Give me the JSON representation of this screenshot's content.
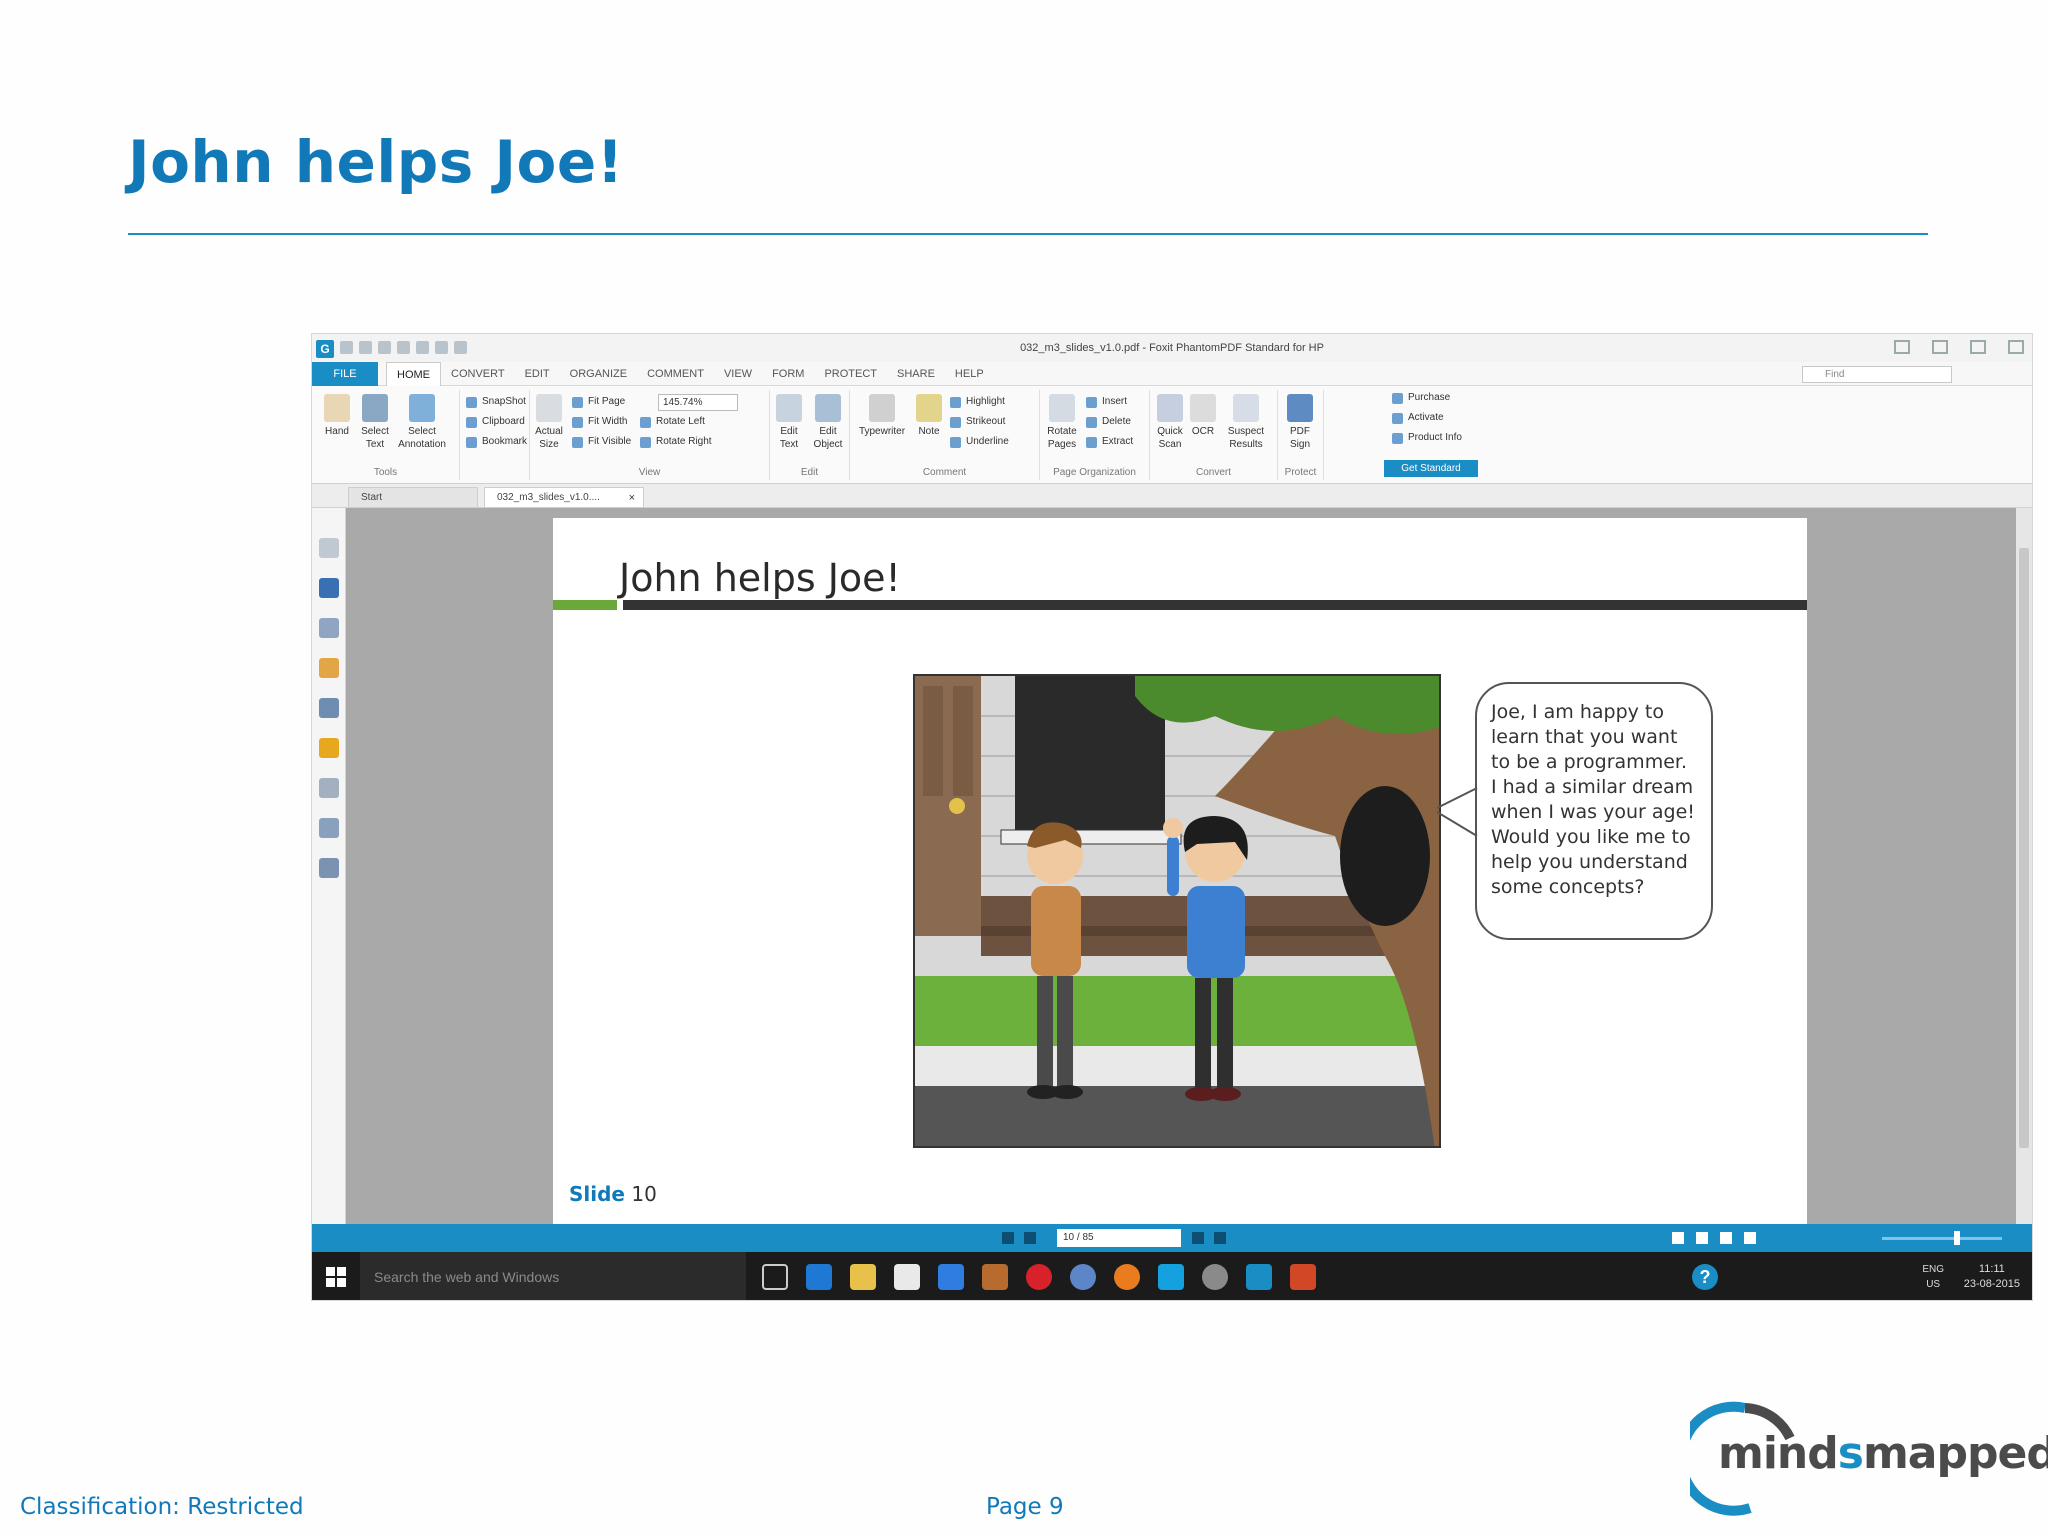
{
  "slide": {
    "title": "John helps Joe!",
    "footer_classification": "Classification: Restricted",
    "footer_page": "Page 9",
    "logo_text_a": "mind",
    "logo_text_b": "s",
    "logo_text_c": "mapped"
  },
  "app": {
    "window_title": "032_m3_slides_v1.0.pdf - Foxit PhantomPDF Standard for HP",
    "file_menu": "FILE",
    "tabs": [
      "HOME",
      "CONVERT",
      "EDIT",
      "ORGANIZE",
      "COMMENT",
      "VIEW",
      "FORM",
      "PROTECT",
      "SHARE",
      "HELP"
    ],
    "find_placeholder": "Find",
    "ribbon": {
      "tools": {
        "label": "Tools",
        "hand": "Hand",
        "select_text": "Select Text",
        "select_annotation": "Select Annotation",
        "snapshot": "SnapShot",
        "clipboard": "Clipboard",
        "bookmark": "Bookmark"
      },
      "view": {
        "label": "View",
        "actual_size": "Actual Size",
        "fit_page": "Fit Page",
        "fit_width": "Fit Width",
        "fit_visible": "Fit Visible",
        "zoom_value": "145.74%",
        "rotate_left": "Rotate Left",
        "rotate_right": "Rotate Right"
      },
      "edit": {
        "label": "Edit",
        "edit_text": "Edit Text",
        "edit_object": "Edit Object"
      },
      "comment": {
        "label": "Comment",
        "typewriter": "Typewriter",
        "note": "Note",
        "highlight": "Highlight",
        "strikeout": "Strikeout",
        "underline": "Underline"
      },
      "page_org": {
        "label": "Page Organization",
        "rotate_pages": "Rotate Pages",
        "insert": "Insert",
        "delete": "Delete",
        "extract": "Extract"
      },
      "convert": {
        "label": "Convert",
        "quick_scan": "Quick Scan",
        "ocr": "OCR",
        "suspect_results": "Suspect Results"
      },
      "protect": {
        "label": "Protect",
        "pdf_sign": "PDF Sign"
      },
      "purchase": "Purchase",
      "activate": "Activate",
      "product_info": "Product Info",
      "get_standard": "Get Standard"
    },
    "doc_tabs": [
      "Start",
      "032_m3_slides_v1.0...."
    ],
    "tab_close": "×",
    "pdf_page": {
      "title": "John helps Joe!",
      "speech": "Joe, I am happy to learn that you want to be a programmer. I had a similar dream when I was your age! Would you like me to help you understand some concepts?",
      "slide_label": "Slide",
      "slide_number": "10"
    },
    "page_indicator": "10 / 85",
    "taskbar": {
      "search_placeholder": "Search the web and Windows",
      "lang": "ENG",
      "region": "US",
      "time": "11:11",
      "date": "23-08-2015",
      "help": "?"
    }
  }
}
